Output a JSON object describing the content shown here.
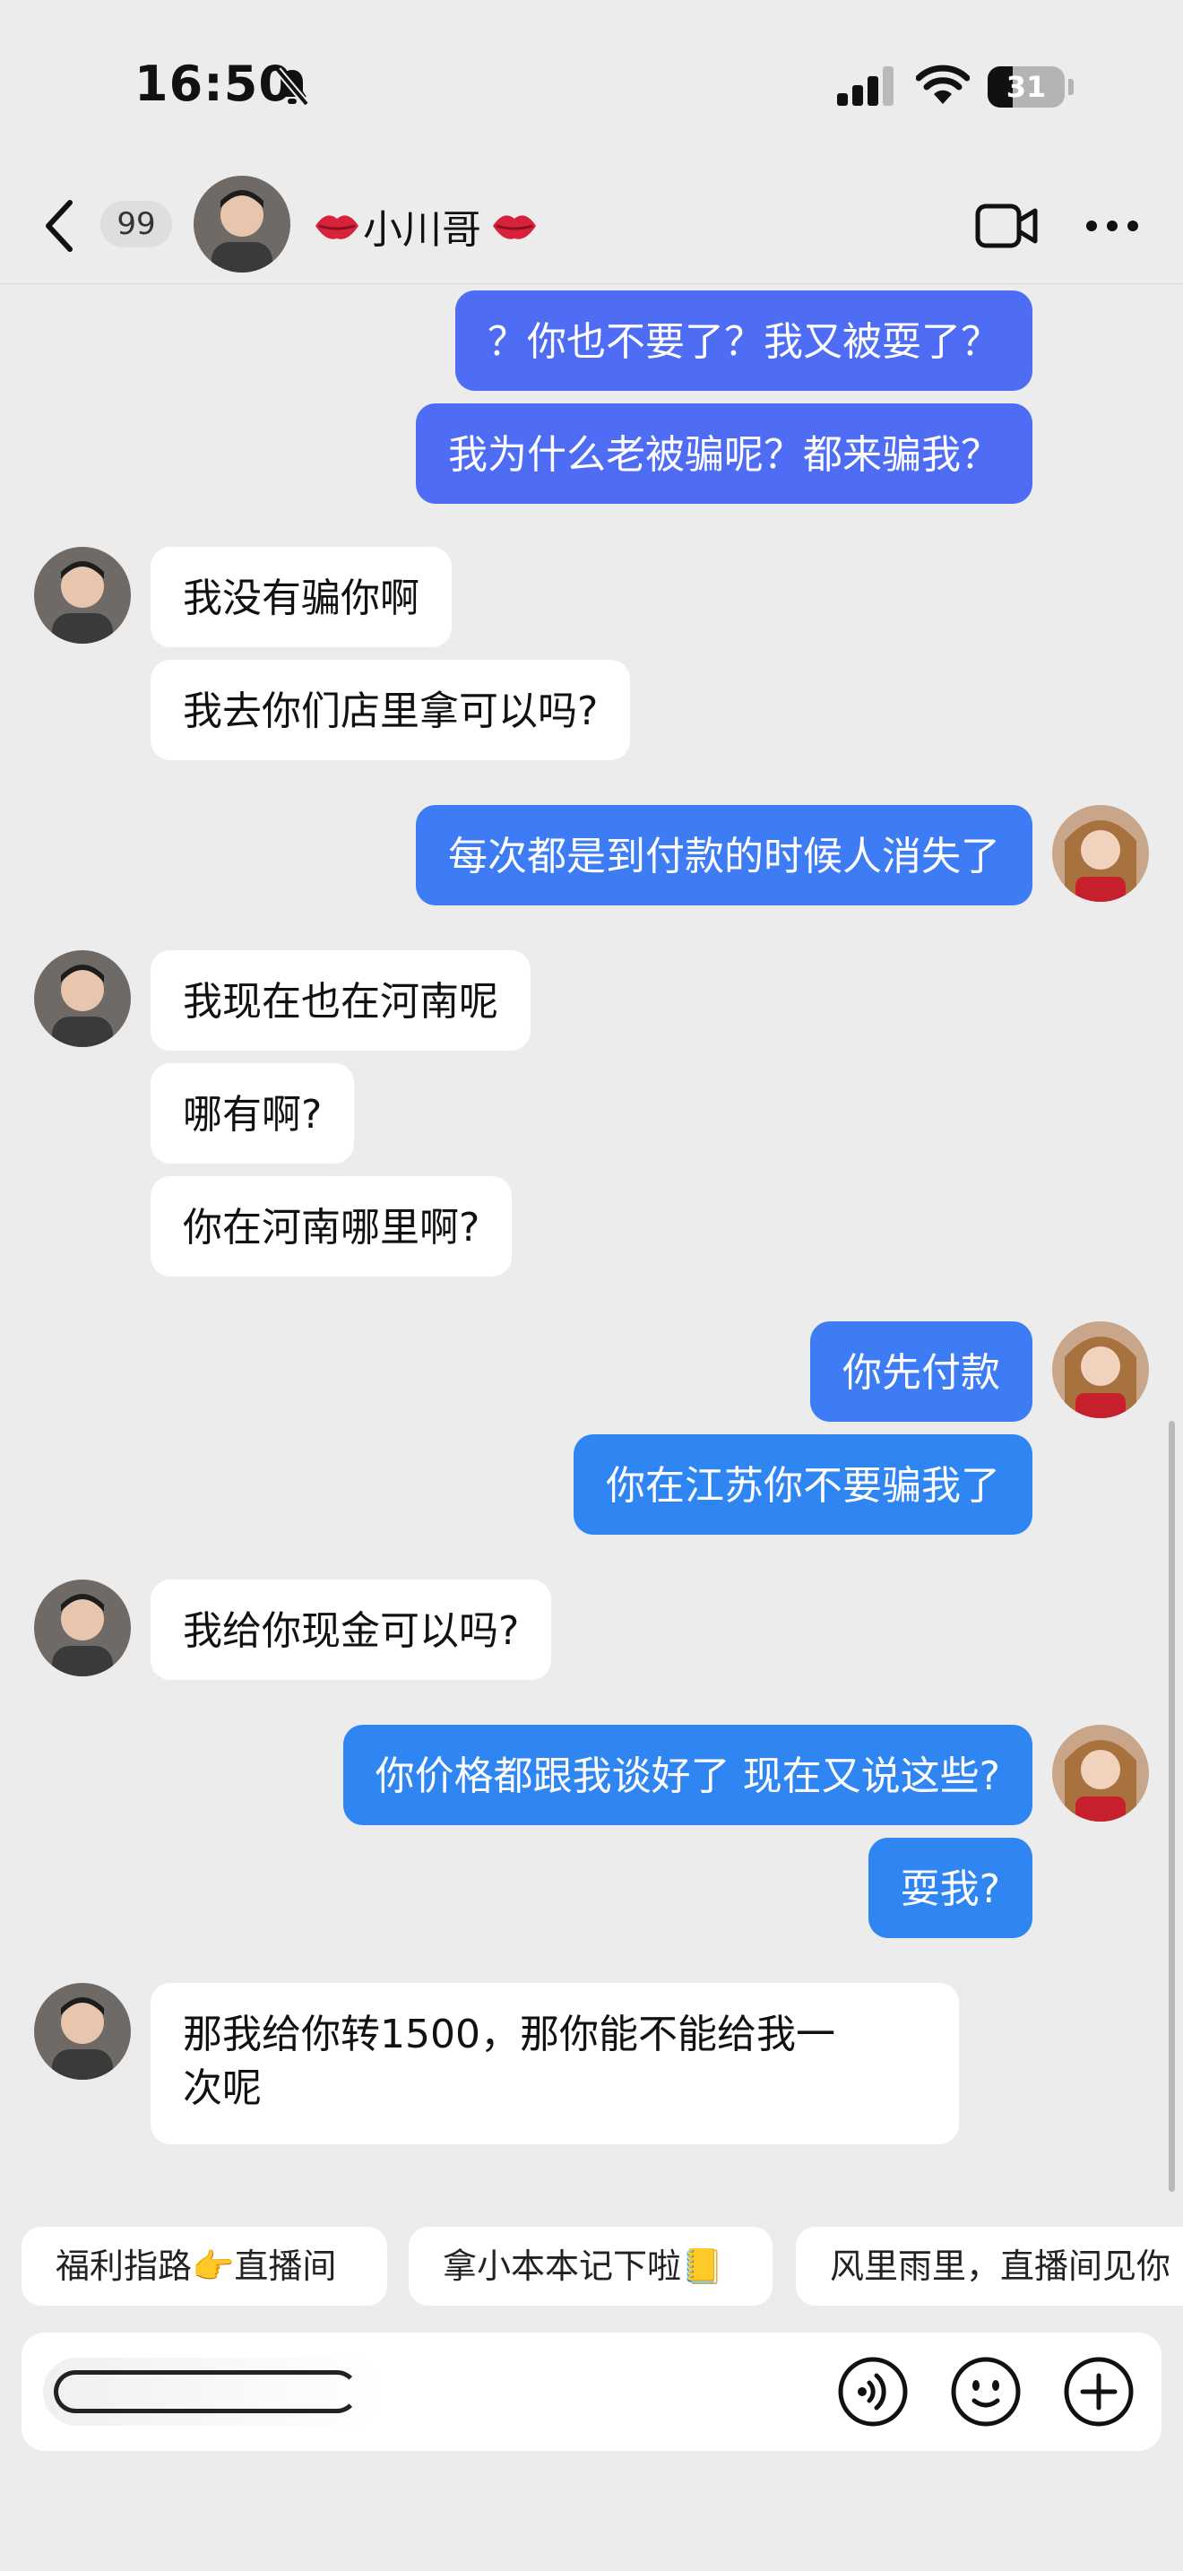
{
  "status_bar": {
    "time": "16:50",
    "battery": "31"
  },
  "header": {
    "unread_count": "99",
    "contact_name": "小川哥"
  },
  "messages": [
    {
      "from": "me",
      "text": "？你也不要了？我又被耍了？"
    },
    {
      "from": "me",
      "text": "我为什么老被骗呢？都来骗我？"
    },
    {
      "from": "other",
      "text": "我没有骗你啊"
    },
    {
      "from": "other",
      "text": "我去你们店里拿可以吗?"
    },
    {
      "from": "me",
      "text": "每次都是到付款的时候人消失了"
    },
    {
      "from": "other",
      "text": "我现在也在河南呢"
    },
    {
      "from": "other",
      "text": "哪有啊?"
    },
    {
      "from": "other",
      "text": "你在河南哪里啊?"
    },
    {
      "from": "me",
      "text": "你先付款"
    },
    {
      "from": "me",
      "text": "你在江苏你不要骗我了"
    },
    {
      "from": "other",
      "text": "我给你现金可以吗?"
    },
    {
      "from": "me",
      "text": "你价格都跟我谈好了 现在又说这些?"
    },
    {
      "from": "me",
      "text": "耍我?"
    },
    {
      "from": "other",
      "text": "那我给你转1500，那你能不能给我一次呢",
      "line1": "那我给你转1500，那你能不能给我一",
      "line2": "次呢"
    }
  ],
  "quick_replies": [
    "福利指路👉直播间",
    "拿小本本记下啦📒",
    "风里雨里，直播间见你"
  ],
  "icons": {
    "back": "chevron-left-icon",
    "video": "video-camera-icon",
    "more": "more-dots-icon",
    "voice": "voice-icon",
    "emoji": "emoji-icon",
    "add": "plus-circle-icon",
    "silent": "bell-slash-icon",
    "signal": "signal-icon",
    "wifi": "wifi-icon",
    "battery": "battery-icon"
  },
  "colors": {
    "background": "#ececec",
    "bubble_other": "#ffffff",
    "bubble_mine": "#4f6cf4",
    "bubble_mine_alt": "#2f86f2"
  }
}
